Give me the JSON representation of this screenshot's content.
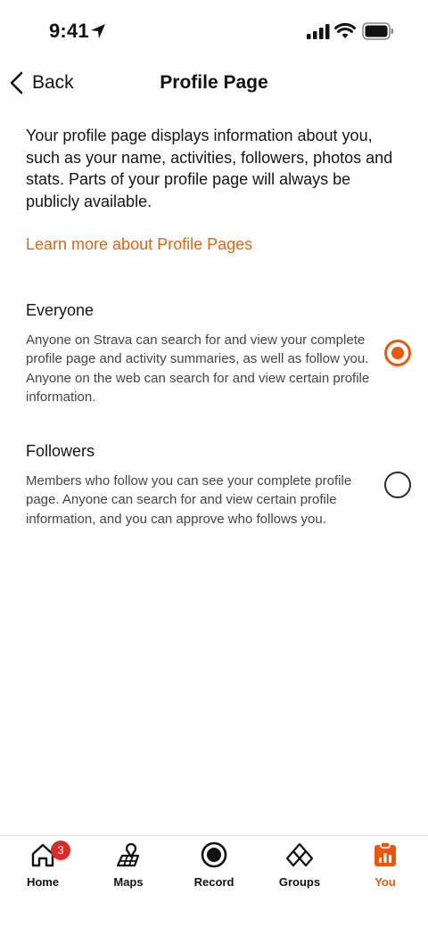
{
  "status_bar": {
    "time": "9:41"
  },
  "header": {
    "back_label": "Back",
    "title": "Profile Page"
  },
  "intro": "Your profile page displays information about you, such as your name, activities, followers, photos and stats. Parts of your profile page will always be publicly available.",
  "learn_more": "Learn more about Profile Pages",
  "options": [
    {
      "title": "Everyone",
      "description": "Anyone on Strava can search for and view your complete profile page and activity summaries, as well as follow you. Anyone on the web can search for and view certain profile information.",
      "selected": true
    },
    {
      "title": "Followers",
      "description": "Members who follow you can see your complete profile page. Anyone can search for and view certain profile information, and you can approve who follows you.",
      "selected": false
    }
  ],
  "tabs": [
    {
      "label": "Home",
      "icon": "home-icon",
      "badge": "3"
    },
    {
      "label": "Maps",
      "icon": "maps-icon"
    },
    {
      "label": "Record",
      "icon": "record-icon"
    },
    {
      "label": "Groups",
      "icon": "groups-icon"
    },
    {
      "label": "You",
      "icon": "you-icon",
      "active": true
    }
  ],
  "colors": {
    "accent": "#e8590c",
    "link": "#d8681a",
    "badge": "#d92b2b"
  }
}
